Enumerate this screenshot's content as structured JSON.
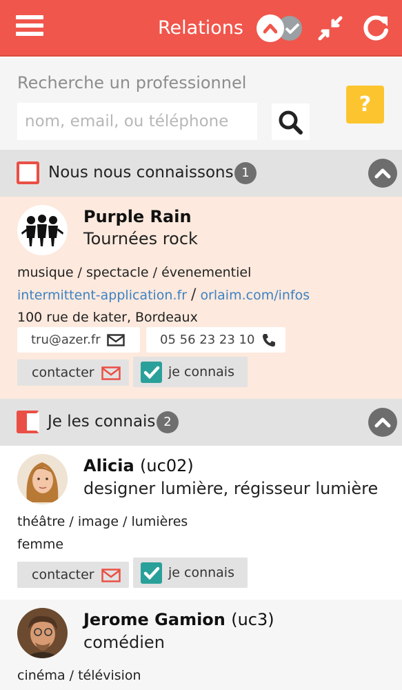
{
  "topbar": {
    "title": "Relations",
    "bg": "#f0564c"
  },
  "search": {
    "label": "Recherche un professionnel",
    "placeholder": "nom, email, ou téléphone",
    "help": "?"
  },
  "sections": [
    {
      "title": "Nous nous connaissons",
      "count": "1"
    },
    {
      "title": "Je les connais",
      "count": "2"
    }
  ],
  "contacts": [
    {
      "name": "Purple Rain",
      "uc": "",
      "title": "Tournées rock",
      "tags": "musique / spectacle / évenementiel",
      "link1": "intermittent-application.fr",
      "sep": "/",
      "link2": "orlaim.com/infos",
      "address": "100 rue de kater, Bordeaux",
      "email": "tru@azer.fr",
      "phone": "05 56 23 23 10",
      "contact_label": "contacter",
      "known_label": "je connais"
    },
    {
      "name": "Alicia",
      "uc": "(uc02)",
      "title": "designer lumière, régisseur lumière",
      "tags": "théâtre / image / lumières",
      "gender": "femme",
      "contact_label": "contacter",
      "known_label": "je connais"
    },
    {
      "name": "Jerome Gamion",
      "uc": "(uc3)",
      "title": "comédien",
      "tags": "cinéma / télévision"
    }
  ],
  "icons": {
    "menu": "hamburger-icon",
    "toggle": "toggle-icon",
    "compress": "compress-icon",
    "refresh": "refresh-icon",
    "search": "search-icon",
    "collapse": "chevron-up-icon",
    "envelope": "envelope-icon",
    "phone": "phone-icon",
    "check": "check-icon"
  },
  "colors": {
    "accent": "#f0564c",
    "teal": "#2aa09a",
    "yellow": "#fcc52f",
    "link": "#3b82c4",
    "card_pink": "#fde9dd"
  }
}
